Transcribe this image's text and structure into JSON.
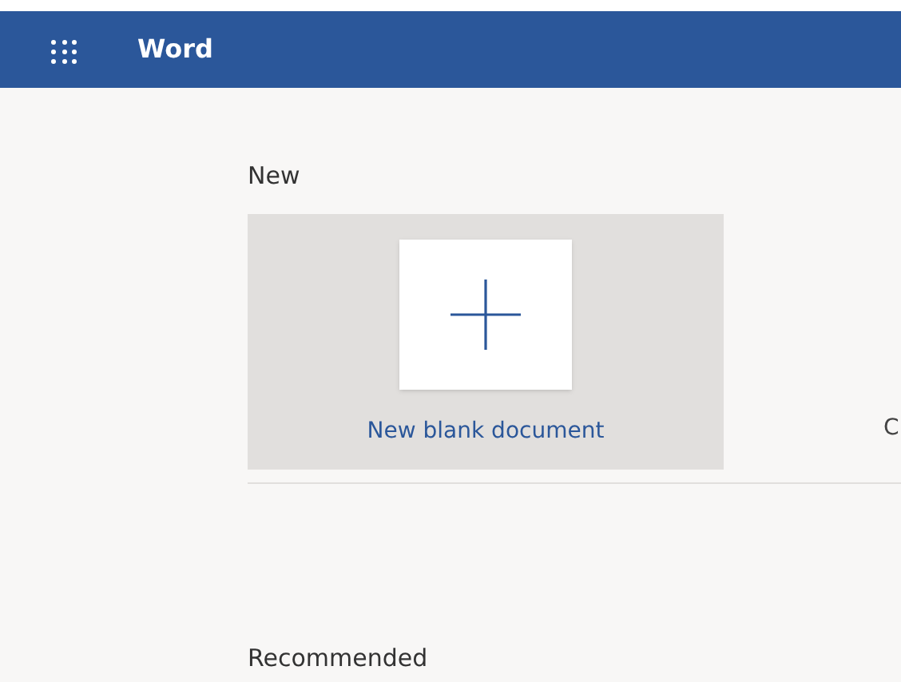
{
  "app_bar": {
    "title": "Word"
  },
  "new_section": {
    "heading": "New",
    "templates": [
      {
        "kind": "blank",
        "label": "New blank document"
      },
      {
        "kind": "cut",
        "label": "C"
      }
    ]
  },
  "recommended": {
    "heading": "Recommended"
  }
}
